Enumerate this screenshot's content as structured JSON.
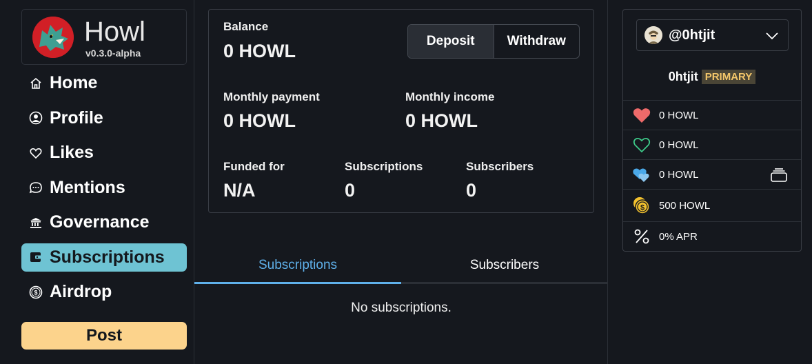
{
  "brand": {
    "title": "Howl",
    "version": "v0.3.0-alpha"
  },
  "nav": {
    "items": [
      {
        "label": "Home",
        "icon": "home-icon"
      },
      {
        "label": "Profile",
        "icon": "user-icon"
      },
      {
        "label": "Likes",
        "icon": "heart-icon"
      },
      {
        "label": "Mentions",
        "icon": "chat-icon"
      },
      {
        "label": "Governance",
        "icon": "bank-icon"
      },
      {
        "label": "Subscriptions",
        "icon": "wallet-icon",
        "active": true
      },
      {
        "label": "Airdrop",
        "icon": "coin-icon"
      }
    ],
    "post_label": "Post"
  },
  "wallet": {
    "balance_label": "Balance",
    "balance_value": "0 HOWL",
    "deposit_label": "Deposit",
    "withdraw_label": "Withdraw",
    "monthly_payment_label": "Monthly payment",
    "monthly_payment_value": "0 HOWL",
    "monthly_income_label": "Monthly income",
    "monthly_income_value": "0 HOWL",
    "funded_for_label": "Funded for",
    "funded_for_value": "N/A",
    "subscriptions_label": "Subscriptions",
    "subscriptions_value": "0",
    "subscribers_label": "Subscribers",
    "subscribers_value": "0"
  },
  "tabs": {
    "subscriptions": "Subscriptions",
    "subscribers": "Subscribers",
    "active": "subscriptions"
  },
  "empty_message": "No subscriptions.",
  "account": {
    "handle": "@0htjit",
    "name": "0htjit",
    "badge": "PRIMARY",
    "rows": {
      "likes_received": "0 HOWL",
      "likes_given": "0 HOWL",
      "pending": "0 HOWL",
      "token_balance": "500 HOWL",
      "apr": "0% APR"
    }
  },
  "colors": {
    "background": "#15181e",
    "accent": "#6ec3d3",
    "post": "#fcd38c",
    "tab_active": "#5fb0ea",
    "heart_red": "#ef6a6a",
    "heart_green": "#3ecb8a",
    "heart_blue": "#4aa8e8",
    "coin_gold": "#f2c12e"
  }
}
